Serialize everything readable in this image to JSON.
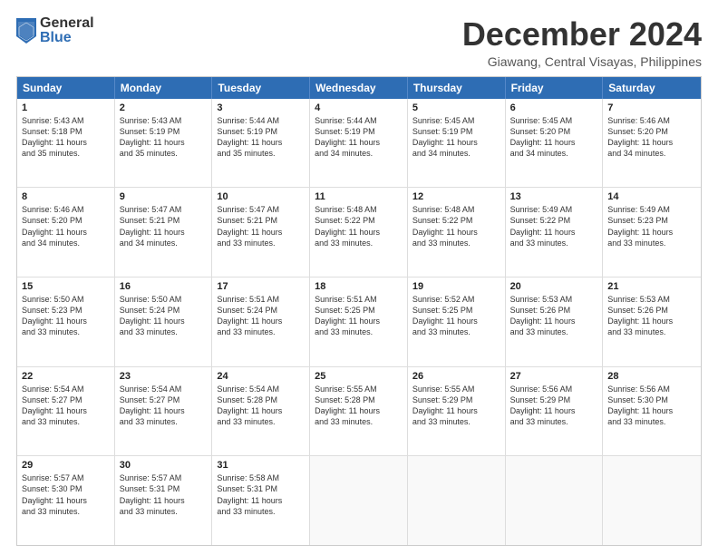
{
  "logo": {
    "general": "General",
    "blue": "Blue"
  },
  "title": "December 2024",
  "location": "Giawang, Central Visayas, Philippines",
  "header_days": [
    "Sunday",
    "Monday",
    "Tuesday",
    "Wednesday",
    "Thursday",
    "Friday",
    "Saturday"
  ],
  "weeks": [
    [
      {
        "day": "1",
        "lines": [
          "Sunrise: 5:43 AM",
          "Sunset: 5:18 PM",
          "Daylight: 11 hours",
          "and 35 minutes."
        ]
      },
      {
        "day": "2",
        "lines": [
          "Sunrise: 5:43 AM",
          "Sunset: 5:19 PM",
          "Daylight: 11 hours",
          "and 35 minutes."
        ]
      },
      {
        "day": "3",
        "lines": [
          "Sunrise: 5:44 AM",
          "Sunset: 5:19 PM",
          "Daylight: 11 hours",
          "and 35 minutes."
        ]
      },
      {
        "day": "4",
        "lines": [
          "Sunrise: 5:44 AM",
          "Sunset: 5:19 PM",
          "Daylight: 11 hours",
          "and 34 minutes."
        ]
      },
      {
        "day": "5",
        "lines": [
          "Sunrise: 5:45 AM",
          "Sunset: 5:19 PM",
          "Daylight: 11 hours",
          "and 34 minutes."
        ]
      },
      {
        "day": "6",
        "lines": [
          "Sunrise: 5:45 AM",
          "Sunset: 5:20 PM",
          "Daylight: 11 hours",
          "and 34 minutes."
        ]
      },
      {
        "day": "7",
        "lines": [
          "Sunrise: 5:46 AM",
          "Sunset: 5:20 PM",
          "Daylight: 11 hours",
          "and 34 minutes."
        ]
      }
    ],
    [
      {
        "day": "8",
        "lines": [
          "Sunrise: 5:46 AM",
          "Sunset: 5:20 PM",
          "Daylight: 11 hours",
          "and 34 minutes."
        ]
      },
      {
        "day": "9",
        "lines": [
          "Sunrise: 5:47 AM",
          "Sunset: 5:21 PM",
          "Daylight: 11 hours",
          "and 34 minutes."
        ]
      },
      {
        "day": "10",
        "lines": [
          "Sunrise: 5:47 AM",
          "Sunset: 5:21 PM",
          "Daylight: 11 hours",
          "and 33 minutes."
        ]
      },
      {
        "day": "11",
        "lines": [
          "Sunrise: 5:48 AM",
          "Sunset: 5:22 PM",
          "Daylight: 11 hours",
          "and 33 minutes."
        ]
      },
      {
        "day": "12",
        "lines": [
          "Sunrise: 5:48 AM",
          "Sunset: 5:22 PM",
          "Daylight: 11 hours",
          "and 33 minutes."
        ]
      },
      {
        "day": "13",
        "lines": [
          "Sunrise: 5:49 AM",
          "Sunset: 5:22 PM",
          "Daylight: 11 hours",
          "and 33 minutes."
        ]
      },
      {
        "day": "14",
        "lines": [
          "Sunrise: 5:49 AM",
          "Sunset: 5:23 PM",
          "Daylight: 11 hours",
          "and 33 minutes."
        ]
      }
    ],
    [
      {
        "day": "15",
        "lines": [
          "Sunrise: 5:50 AM",
          "Sunset: 5:23 PM",
          "Daylight: 11 hours",
          "and 33 minutes."
        ]
      },
      {
        "day": "16",
        "lines": [
          "Sunrise: 5:50 AM",
          "Sunset: 5:24 PM",
          "Daylight: 11 hours",
          "and 33 minutes."
        ]
      },
      {
        "day": "17",
        "lines": [
          "Sunrise: 5:51 AM",
          "Sunset: 5:24 PM",
          "Daylight: 11 hours",
          "and 33 minutes."
        ]
      },
      {
        "day": "18",
        "lines": [
          "Sunrise: 5:51 AM",
          "Sunset: 5:25 PM",
          "Daylight: 11 hours",
          "and 33 minutes."
        ]
      },
      {
        "day": "19",
        "lines": [
          "Sunrise: 5:52 AM",
          "Sunset: 5:25 PM",
          "Daylight: 11 hours",
          "and 33 minutes."
        ]
      },
      {
        "day": "20",
        "lines": [
          "Sunrise: 5:53 AM",
          "Sunset: 5:26 PM",
          "Daylight: 11 hours",
          "and 33 minutes."
        ]
      },
      {
        "day": "21",
        "lines": [
          "Sunrise: 5:53 AM",
          "Sunset: 5:26 PM",
          "Daylight: 11 hours",
          "and 33 minutes."
        ]
      }
    ],
    [
      {
        "day": "22",
        "lines": [
          "Sunrise: 5:54 AM",
          "Sunset: 5:27 PM",
          "Daylight: 11 hours",
          "and 33 minutes."
        ]
      },
      {
        "day": "23",
        "lines": [
          "Sunrise: 5:54 AM",
          "Sunset: 5:27 PM",
          "Daylight: 11 hours",
          "and 33 minutes."
        ]
      },
      {
        "day": "24",
        "lines": [
          "Sunrise: 5:54 AM",
          "Sunset: 5:28 PM",
          "Daylight: 11 hours",
          "and 33 minutes."
        ]
      },
      {
        "day": "25",
        "lines": [
          "Sunrise: 5:55 AM",
          "Sunset: 5:28 PM",
          "Daylight: 11 hours",
          "and 33 minutes."
        ]
      },
      {
        "day": "26",
        "lines": [
          "Sunrise: 5:55 AM",
          "Sunset: 5:29 PM",
          "Daylight: 11 hours",
          "and 33 minutes."
        ]
      },
      {
        "day": "27",
        "lines": [
          "Sunrise: 5:56 AM",
          "Sunset: 5:29 PM",
          "Daylight: 11 hours",
          "and 33 minutes."
        ]
      },
      {
        "day": "28",
        "lines": [
          "Sunrise: 5:56 AM",
          "Sunset: 5:30 PM",
          "Daylight: 11 hours",
          "and 33 minutes."
        ]
      }
    ],
    [
      {
        "day": "29",
        "lines": [
          "Sunrise: 5:57 AM",
          "Sunset: 5:30 PM",
          "Daylight: 11 hours",
          "and 33 minutes."
        ]
      },
      {
        "day": "30",
        "lines": [
          "Sunrise: 5:57 AM",
          "Sunset: 5:31 PM",
          "Daylight: 11 hours",
          "and 33 minutes."
        ]
      },
      {
        "day": "31",
        "lines": [
          "Sunrise: 5:58 AM",
          "Sunset: 5:31 PM",
          "Daylight: 11 hours",
          "and 33 minutes."
        ]
      },
      {
        "day": "",
        "lines": []
      },
      {
        "day": "",
        "lines": []
      },
      {
        "day": "",
        "lines": []
      },
      {
        "day": "",
        "lines": []
      }
    ]
  ]
}
